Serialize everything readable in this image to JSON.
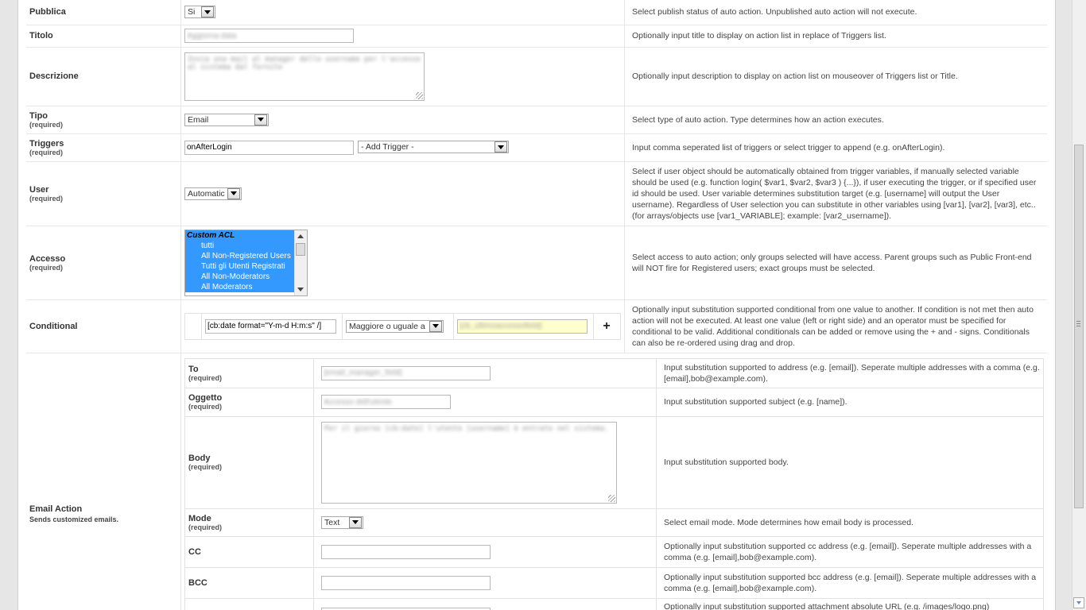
{
  "rows": {
    "pubblica": {
      "label": "Pubblica",
      "value": "Si",
      "desc": "Select publish status of auto action. Unpublished auto action will not execute."
    },
    "titolo": {
      "label": "Titolo",
      "value": "Aggiorna data",
      "desc": "Optionally input title to display on action list in replace of Triggers list."
    },
    "descrizione": {
      "label": "Descrizione",
      "value": "Invia una mail al manager dello username per l'accesso al sistema dal fornito",
      "desc": "Optionally input description to display on action list on mouseover of Triggers list or Title."
    },
    "tipo": {
      "label": "Tipo",
      "required": "(required)",
      "value": "Email",
      "desc": "Select type of auto action. Type determines how an action executes."
    },
    "triggers": {
      "label": "Triggers",
      "required": "(required)",
      "value": "onAfterLogin",
      "add": "- Add Trigger -",
      "desc": "Input comma seperated list of triggers or select trigger to append (e.g. onAfterLogin)."
    },
    "user": {
      "label": "User",
      "required": "(required)",
      "value": "Automatic",
      "desc": "Select if user object should be automatically obtained from trigger variables, if manually selected variable should be used (e.g. function login( $var1, $var2, $var3 ) {...}), if user executing the trigger, or if specified user id should be used. User variable determines substitution target (e.g. [username] will output the User username). Regardless of User selection you can substitute in other variables using [var1], [var2], [var3], etc.. (for arrays/objects use [var1_VARIABLE]; example: [var2_username])."
    },
    "accesso": {
      "label": "Accesso",
      "required": "(required)",
      "group": "Custom ACL",
      "options": [
        "tutti",
        "All Non-Registered Users",
        "Tutti gli Utenti Registrati",
        "All Non-Moderators",
        "All Moderators"
      ],
      "desc": "Select access to auto action; only groups selected will have access. Parent groups such as Public Front-end will NOT fire for Registered users; exact groups must be selected."
    },
    "conditional": {
      "label": "Conditional",
      "left": "[cb:date format=\"Y-m-d H:m:s\" /]",
      "operator": "Maggiore o uguale a",
      "right": "[cb_ultimoaccessofield]",
      "plus": "+",
      "desc": "Optionally input substitution supported conditional from one value to another. If condition is not met then auto action will not be executed. At least one value (left or right side) and an operator must be specified for conditional to be valid. Additional conditionals can be added or remove using the + and - signs. Conditionals can also be re-ordered using drag and drop."
    },
    "email_action": {
      "label": "Email Action",
      "sub": "Sends customized emails.",
      "to": {
        "label": "To",
        "required": "(required)",
        "value": "[email_manager_field]",
        "desc": "Input substitution supported to address (e.g. [email]). Seperate multiple addresses with a comma (e.g. [email],bob@example.com)."
      },
      "oggetto": {
        "label": "Oggetto",
        "required": "(required)",
        "value": "Accesso dell'utente",
        "desc": "Input substitution supported subject (e.g. [name])."
      },
      "body": {
        "label": "Body",
        "required": "(required)",
        "value": "Per il giorno [cb:date] l'utente [username] è entrato nel sistema.",
        "desc": "Input substitution supported body."
      },
      "mode": {
        "label": "Mode",
        "required": "(required)",
        "value": "Text",
        "desc": "Select email mode. Mode determines how email body is processed."
      },
      "cc": {
        "label": "CC",
        "value": "",
        "desc": "Optionally input substitution supported cc address (e.g. [email]). Seperate multiple addresses with a comma (e.g. [email],bob@example.com)."
      },
      "bcc": {
        "label": "BCC",
        "value": "",
        "desc": "Optionally input substitution supported bcc address (e.g. [email]). Seperate multiple addresses with a comma (e.g. [email],bob@example.com)."
      },
      "attachment": {
        "desc": "Optionally input substitution supported attachment absolute URL (e.g. /images/logo.png)"
      }
    }
  }
}
